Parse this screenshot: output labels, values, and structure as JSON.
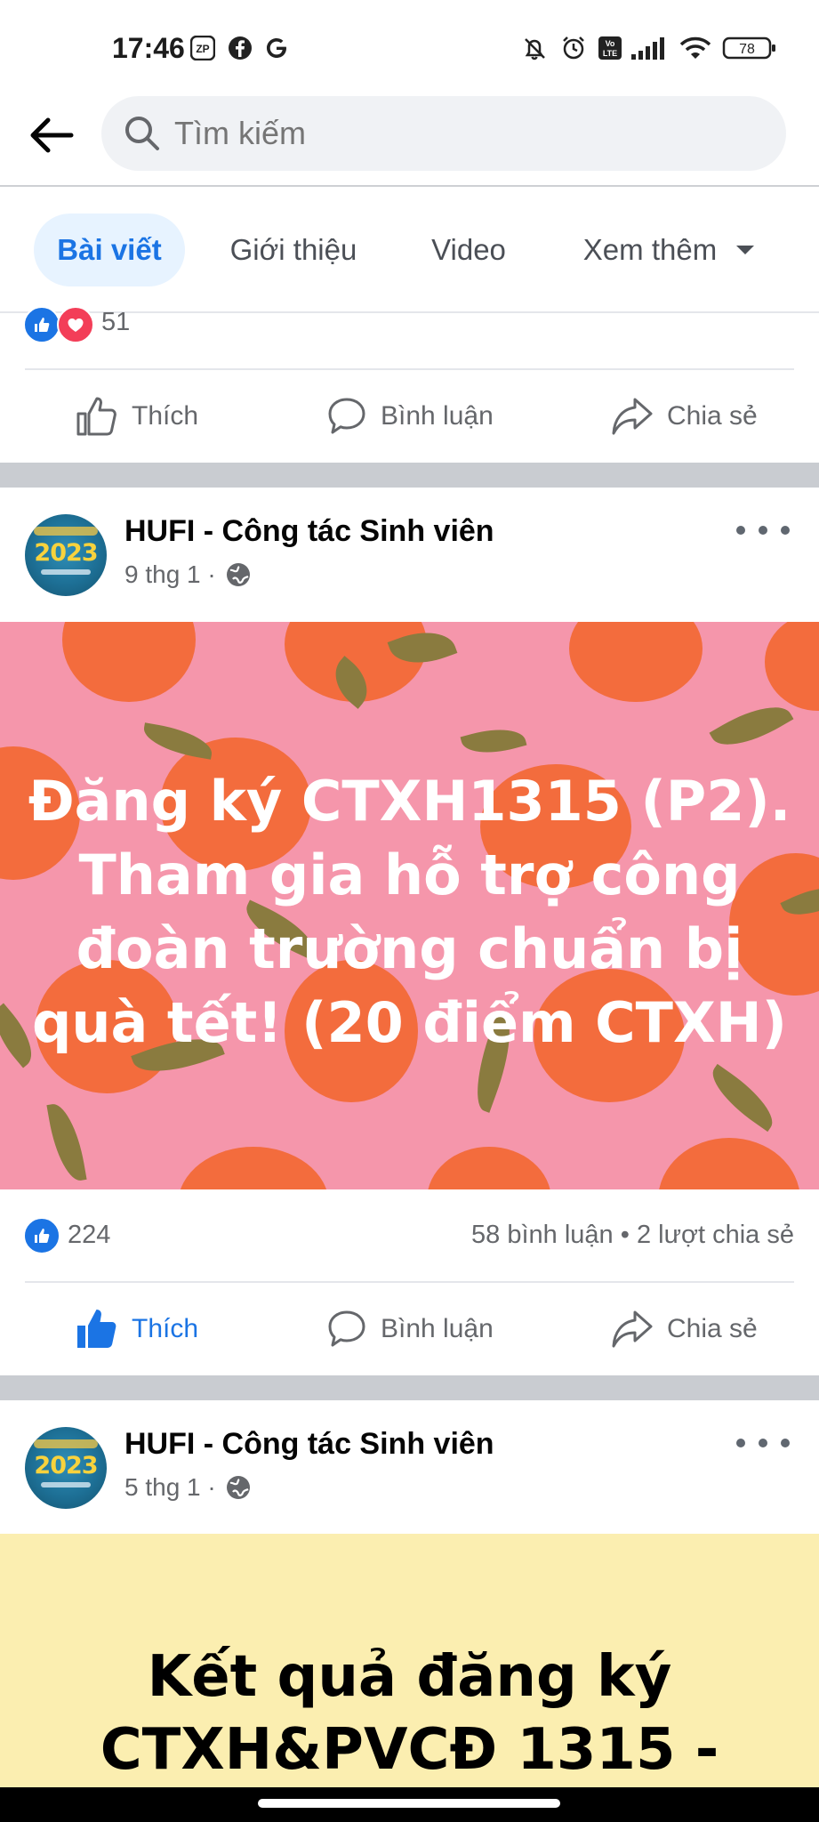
{
  "status_bar": {
    "time": "17:46",
    "left_icons": [
      "zalo-icon",
      "facebook-icon",
      "google-icon"
    ],
    "right_icons": [
      "mute-bell-icon",
      "alarm-icon",
      "volte-icon",
      "signal-icon",
      "wifi-icon",
      "battery-icon"
    ],
    "battery": "78",
    "volte_label": "Vo LTE",
    "zalo_label": "ZP"
  },
  "header": {
    "search_placeholder": "Tìm kiếm"
  },
  "tabs": [
    {
      "label": "Bài viết",
      "active": true
    },
    {
      "label": "Giới thiệu",
      "active": false
    },
    {
      "label": "Video",
      "active": false
    },
    {
      "label": "Xem thêm",
      "active": false
    }
  ],
  "previous_post": {
    "reaction_count": "51",
    "actions": {
      "like": "Thích",
      "comment": "Bình luận",
      "share": "Chia sẻ"
    }
  },
  "posts": [
    {
      "page_name": "HUFI - Công tác Sinh viên",
      "time": "9 thg 1 ·",
      "avatar_year": "2023",
      "image_text": [
        "Đăng ký CTXH1315 (P2).",
        "Tham gia hỗ trợ công",
        "đoàn trường chuẩn bị",
        "quà tết! (20 điểm CTXH)"
      ],
      "reaction_count": "224",
      "comments_shares": "58 bình luận • 2 lượt chia sẻ",
      "actions": {
        "like": "Thích",
        "comment": "Bình luận",
        "share": "Chia sẻ"
      },
      "liked": true
    },
    {
      "page_name": "HUFI - Công tác Sinh viên",
      "time": "5 thg 1 ·",
      "avatar_year": "2023",
      "image_text": [
        "Kết quả đăng ký",
        "CTXH&PVCĐ 1315 -"
      ]
    }
  ],
  "colors": {
    "accent": "#1b74e4",
    "post1_bg": "#f596ab",
    "orange": "#f36c3d",
    "post2_bg": "#fbeeb0"
  }
}
